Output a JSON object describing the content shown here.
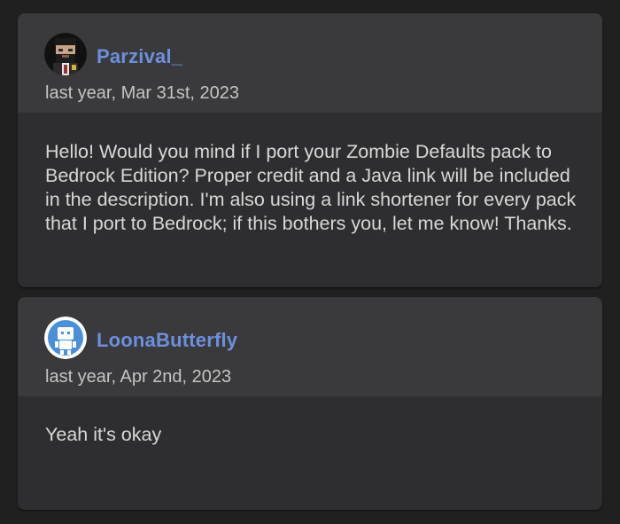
{
  "comments": [
    {
      "username": "Parzival_",
      "timestamp": "last year, Mar 31st, 2023",
      "avatar_icon": "pixel-character-avatar-icon",
      "body": "Hello! Would you mind if I port your Zombie Defaults pack to Bedrock Edition? Proper credit and a Java link will be included in the description. I'm also using a link shortener for every pack that I port to Bedrock; if this bothers you, let me know! Thanks."
    },
    {
      "username": "LoonaButterfly",
      "timestamp": "last year, Apr 2nd, 2023",
      "avatar_icon": "default-robot-avatar-icon",
      "body": "Yeah it's okay"
    }
  ],
  "colors": {
    "background": "#202020",
    "card": "#2e2e30",
    "card_header": "#3a3a3c",
    "username": "#6d8fdc",
    "text": "#d8d8d8",
    "timestamp": "#c4c4c4"
  }
}
